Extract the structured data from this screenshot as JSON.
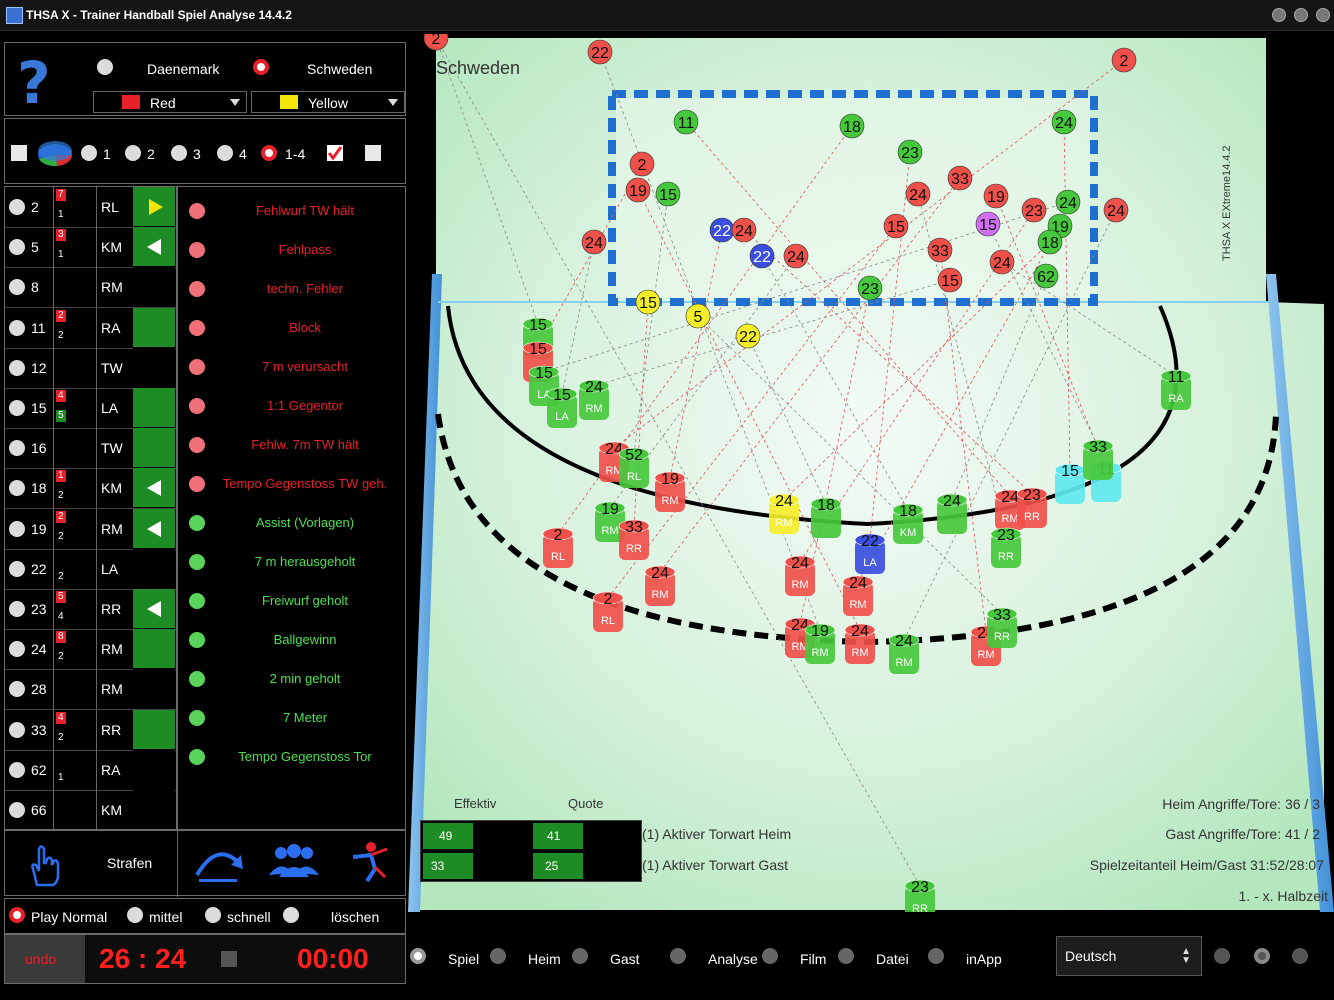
{
  "window": {
    "title": "THSA X - Trainer Handball Spiel Analyse 14.4.2"
  },
  "teams": {
    "home": "Daenemark",
    "away": "Schweden",
    "selected": "away",
    "home_color": {
      "label": "Red",
      "hex": "#e8202a"
    },
    "away_color": {
      "label": "Yellow",
      "hex": "#f4e50a"
    }
  },
  "period_options": {
    "items": [
      "1",
      "2",
      "3",
      "4",
      "1-4"
    ],
    "selected": "1-4"
  },
  "players": [
    {
      "number": "2",
      "position": "RL",
      "count_top": "7",
      "count_bottom": "1"
    },
    {
      "number": "5",
      "position": "KM",
      "count_top": "3",
      "count_bottom": "1"
    },
    {
      "number": "8",
      "position": "RM",
      "count_top": "",
      "count_bottom": ""
    },
    {
      "number": "11",
      "position": "RA",
      "count_top": "2",
      "count_bottom": "2"
    },
    {
      "number": "12",
      "position": "TW",
      "count_top": "",
      "count_bottom": ""
    },
    {
      "number": "15",
      "position": "LA",
      "count_top": "4",
      "count_bottom": "5"
    },
    {
      "number": "16",
      "position": "TW",
      "count_top": "",
      "count_bottom": ""
    },
    {
      "number": "18",
      "position": "KM",
      "count_top": "1",
      "count_bottom": "2"
    },
    {
      "number": "19",
      "position": "RM",
      "count_top": "2",
      "count_bottom": "2"
    },
    {
      "number": "22",
      "position": "LA",
      "count_top": "",
      "count_bottom": "2"
    },
    {
      "number": "23",
      "position": "RR",
      "count_top": "5",
      "count_bottom": "4"
    },
    {
      "number": "24",
      "position": "RM",
      "count_top": "8",
      "count_bottom": "2"
    },
    {
      "number": "28",
      "position": "RM",
      "count_top": "",
      "count_bottom": ""
    },
    {
      "number": "33",
      "position": "RR",
      "count_top": "4",
      "count_bottom": "2"
    },
    {
      "number": "62",
      "position": "RA",
      "count_top": "",
      "count_bottom": "1"
    },
    {
      "number": "66",
      "position": "KM",
      "count_top": "",
      "count_bottom": ""
    }
  ],
  "events_negative": [
    "Fehlwurf TW hält",
    "Fehlpass",
    "techn. Fehler",
    "Block",
    "7 m verursacht",
    "1:1 Gegentor",
    "Fehlw. 7m TW hält",
    "Tempo Gegenstoss TW geh."
  ],
  "events_positive": [
    "Assist (Vorlagen)",
    "7 m herausgeholt",
    "Freiwurf geholt",
    "Ballgewinn",
    "2 min geholt",
    "7 Meter",
    "Tempo Gegenstoss Tor"
  ],
  "toolbar": {
    "penalties": "Strafen"
  },
  "playback": {
    "options": [
      "Play Normal",
      "mittel",
      "schnell",
      "löschen"
    ],
    "selected": "Play Normal"
  },
  "score": {
    "undo": "undo",
    "score": "26 : 24",
    "time": "00:00"
  },
  "field": {
    "team_label": "Schweden",
    "version": "THSA X EXtreme14.4.2",
    "effektiv_label": "Effektiv",
    "quote_label": "Quote",
    "goalkeeper": [
      {
        "effektiv": "49",
        "quote": "41",
        "label": "(1) Aktiver Torwart Heim"
      },
      {
        "effektiv": "33",
        "quote": "25",
        "label": "(1) Aktiver Torwart Gast"
      }
    ],
    "stats": [
      "Heim Angriffe/Tore: 36 / 3",
      "Gast Angriffe/Tore: 41 / 2",
      "Spielzeitanteil Heim/Gast 31:52/28:07",
      "1. - x. Halbzeit"
    ],
    "goal_markers": [
      {
        "n": "2",
        "c": "r"
      },
      {
        "n": "22",
        "c": "r"
      },
      {
        "n": "2",
        "c": "r"
      },
      {
        "n": "11",
        "c": "g"
      },
      {
        "n": "18",
        "c": "g"
      },
      {
        "n": "24",
        "c": "g"
      },
      {
        "n": "23",
        "c": "g"
      },
      {
        "n": "2",
        "c": "r"
      },
      {
        "n": "19",
        "c": "r"
      },
      {
        "n": "15",
        "c": "g"
      },
      {
        "n": "24",
        "c": "r"
      },
      {
        "n": "33",
        "c": "r"
      },
      {
        "n": "19",
        "c": "r"
      },
      {
        "n": "23",
        "c": "r"
      },
      {
        "n": "24",
        "c": "g"
      },
      {
        "n": "24",
        "c": "r"
      },
      {
        "n": "22",
        "c": "b"
      },
      {
        "n": "24",
        "c": "r"
      },
      {
        "n": "15",
        "c": "r"
      },
      {
        "n": "15",
        "c": "p"
      },
      {
        "n": "19",
        "c": "g"
      },
      {
        "n": "24",
        "c": "r"
      },
      {
        "n": "22",
        "c": "b"
      },
      {
        "n": "24",
        "c": "r"
      },
      {
        "n": "33",
        "c": "r"
      },
      {
        "n": "18",
        "c": "g"
      },
      {
        "n": "24",
        "c": "r"
      },
      {
        "n": "23",
        "c": "g"
      },
      {
        "n": "15",
        "c": "r"
      },
      {
        "n": "62",
        "c": "g"
      },
      {
        "n": "15",
        "c": "y"
      },
      {
        "n": "5",
        "c": "y"
      },
      {
        "n": "22",
        "c": "y"
      }
    ],
    "shooters": [
      {
        "n": "15",
        "pos": "",
        "c": "g"
      },
      {
        "n": "15",
        "pos": "",
        "c": "r"
      },
      {
        "n": "15",
        "pos": "LA",
        "c": "g"
      },
      {
        "n": "15",
        "pos": "LA",
        "c": "g"
      },
      {
        "n": "24",
        "pos": "RM",
        "c": "g"
      },
      {
        "n": "24",
        "pos": "RM",
        "c": "r"
      },
      {
        "n": "52",
        "pos": "RL",
        "c": "g"
      },
      {
        "n": "19",
        "pos": "RM",
        "c": "r"
      },
      {
        "n": "19",
        "pos": "RM",
        "c": "g"
      },
      {
        "n": "33",
        "pos": "RR",
        "c": "r"
      },
      {
        "n": "2",
        "pos": "RL",
        "c": "r"
      },
      {
        "n": "24",
        "pos": "RM",
        "c": "r"
      },
      {
        "n": "2",
        "pos": "RL",
        "c": "r"
      },
      {
        "n": "24",
        "pos": "RM",
        "c": "y"
      },
      {
        "n": "18",
        "pos": "",
        "c": "g"
      },
      {
        "n": "22",
        "pos": "LA",
        "c": "b"
      },
      {
        "n": "24",
        "pos": "RM",
        "c": "r"
      },
      {
        "n": "24",
        "pos": "RM",
        "c": "r"
      },
      {
        "n": "24",
        "pos": "RM",
        "c": "r"
      },
      {
        "n": "19",
        "pos": "RM",
        "c": "g"
      },
      {
        "n": "24",
        "pos": "RM",
        "c": "r"
      },
      {
        "n": "24",
        "pos": "RM",
        "c": "g"
      },
      {
        "n": "18",
        "pos": "KM",
        "c": "g"
      },
      {
        "n": "24",
        "pos": "",
        "c": "g"
      },
      {
        "n": "24",
        "pos": "RM",
        "c": "r"
      },
      {
        "n": "23",
        "pos": "RR",
        "c": "g"
      },
      {
        "n": "23",
        "pos": "RR",
        "c": "r"
      },
      {
        "n": "24",
        "pos": "RM",
        "c": "r"
      },
      {
        "n": "33",
        "pos": "RR",
        "c": "g"
      },
      {
        "n": "15",
        "pos": "",
        "c": "c"
      },
      {
        "n": "11",
        "pos": "",
        "c": "c"
      },
      {
        "n": "33",
        "pos": "",
        "c": "g"
      },
      {
        "n": "11",
        "pos": "RA",
        "c": "g"
      },
      {
        "n": "23",
        "pos": "RR",
        "c": "g"
      }
    ]
  },
  "nav": {
    "items": [
      "Spiel",
      "Heim",
      "Gast",
      "Analyse",
      "Film",
      "Datei",
      "inApp"
    ],
    "selected": "Spiel",
    "language": "Deutsch"
  }
}
